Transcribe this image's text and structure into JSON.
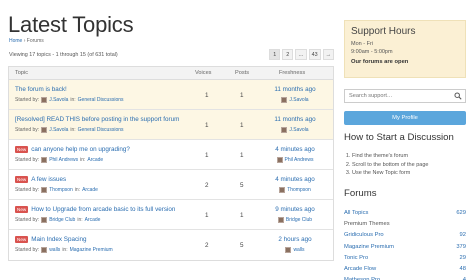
{
  "page": {
    "title": "Latest Topics",
    "breadcrumb": [
      "Home",
      "Forums"
    ],
    "breadcrumb_sep": "›",
    "viewing": "Viewing 17 topics - 1 through 15 (of 631 total)",
    "pagination": [
      "1",
      "2",
      "…",
      "43",
      "→"
    ]
  },
  "table": {
    "headers": {
      "topic": "Topic",
      "voices": "Voices",
      "posts": "Posts",
      "freshness": "Freshness"
    },
    "started_by_prefix": "Started by:",
    "in_word": "in:",
    "rows": [
      {
        "badge": "",
        "title": "The forum is back!",
        "author": "J.Savola",
        "forum": "General Discussions",
        "voices": "1",
        "posts": "1",
        "freshness": "11 months ago",
        "last_by": "J.Savola",
        "sticky": true
      },
      {
        "badge": "",
        "title": "[Resolved] READ THIS before posting in the support forum",
        "author": "J.Savola",
        "forum": "General Discussions",
        "voices": "1",
        "posts": "1",
        "freshness": "11 months ago",
        "last_by": "J.Savola",
        "sticky": true
      },
      {
        "badge": "New",
        "title": "can anyone help me on upgrading?",
        "author": "Phil Andrews",
        "forum": "Arcade",
        "voices": "1",
        "posts": "1",
        "freshness": "4 minutes ago",
        "last_by": "Phil Andrews",
        "sticky": false
      },
      {
        "badge": "New",
        "title": "A few issues",
        "author": "Thompson",
        "forum": "Arcade",
        "voices": "2",
        "posts": "5",
        "freshness": "4 minutes ago",
        "last_by": "Thompson",
        "sticky": false
      },
      {
        "badge": "New",
        "title": "How to Upgrade from arcade basic to its full version",
        "author": "Bridge Club",
        "forum": "Arcade",
        "voices": "1",
        "posts": "1",
        "freshness": "9 minutes ago",
        "last_by": "Bridge Club",
        "sticky": false
      },
      {
        "badge": "New",
        "title": "Main Index Spacing",
        "author": "walls",
        "forum": "Magazine Premium",
        "voices": "2",
        "posts": "5",
        "freshness": "2 hours ago",
        "last_by": "walls",
        "sticky": false
      }
    ]
  },
  "sidebar": {
    "support_hours": {
      "title": "Support Hours",
      "days": "Mon - Fri",
      "time": "9:00am - 5:00pm",
      "status": "Our forums are open"
    },
    "search_placeholder": "Search support…",
    "profile_button": "My Profile",
    "how_to_title": "How to Start a Discussion",
    "steps": [
      "Find the theme's forum",
      "Scroll to the bottom of the page",
      "Use the New Topic form"
    ],
    "forums_title": "Forums",
    "forums": [
      {
        "label": "All Topics",
        "count": "629",
        "type": "link"
      },
      {
        "label": "Premium Themes",
        "count": "",
        "type": "heading"
      },
      {
        "label": "Gridiculous Pro",
        "count": "92",
        "type": "link"
      },
      {
        "label": "Magazine Premium",
        "count": "379",
        "type": "link"
      },
      {
        "label": "Tonic Pro",
        "count": "29",
        "type": "link"
      },
      {
        "label": "Arcade Flow",
        "count": "48",
        "type": "link"
      },
      {
        "label": "Matheson Pro",
        "count": "4",
        "type": "link"
      }
    ]
  },
  "colors": {
    "link": "#2a6db0",
    "new_badge": "#d9534f",
    "sticky_row": "#fdf7e4",
    "support_box": "#fbf0d4",
    "profile_button": "#5ba6dc"
  }
}
